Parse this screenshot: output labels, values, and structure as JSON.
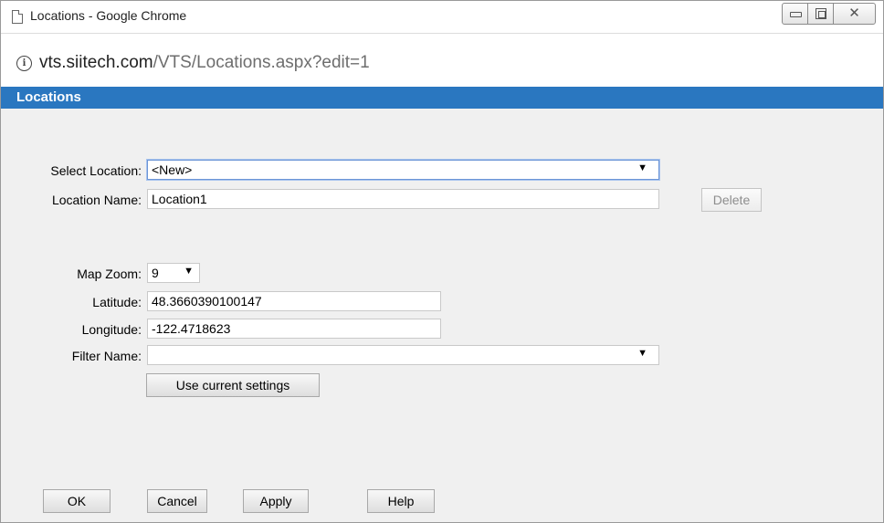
{
  "window": {
    "title": "Locations - Google Chrome"
  },
  "addressbar": {
    "host": "vts.siitech.com",
    "path": "/VTS/Locations.aspx?edit=1"
  },
  "header": {
    "title": "Locations"
  },
  "form": {
    "select_location_label": "Select Location:",
    "select_location_value": "<New>",
    "location_name_label": "Location Name:",
    "location_name_value": "Location1",
    "delete_label": "Delete",
    "map_zoom_label": "Map Zoom:",
    "map_zoom_value": "9",
    "latitude_label": "Latitude:",
    "latitude_value": "48.3660390100147",
    "longitude_label": "Longitude:",
    "longitude_value": "-122.4718623",
    "filter_name_label": "Filter Name:",
    "filter_name_value": "",
    "use_current_label": "Use current settings"
  },
  "footer": {
    "ok": "OK",
    "cancel": "Cancel",
    "apply": "Apply",
    "help": "Help"
  },
  "icons": {
    "dropdown": "▼",
    "close": "✕"
  },
  "colors": {
    "header_bg": "#2a77c0",
    "header_text": "#ffffff"
  }
}
